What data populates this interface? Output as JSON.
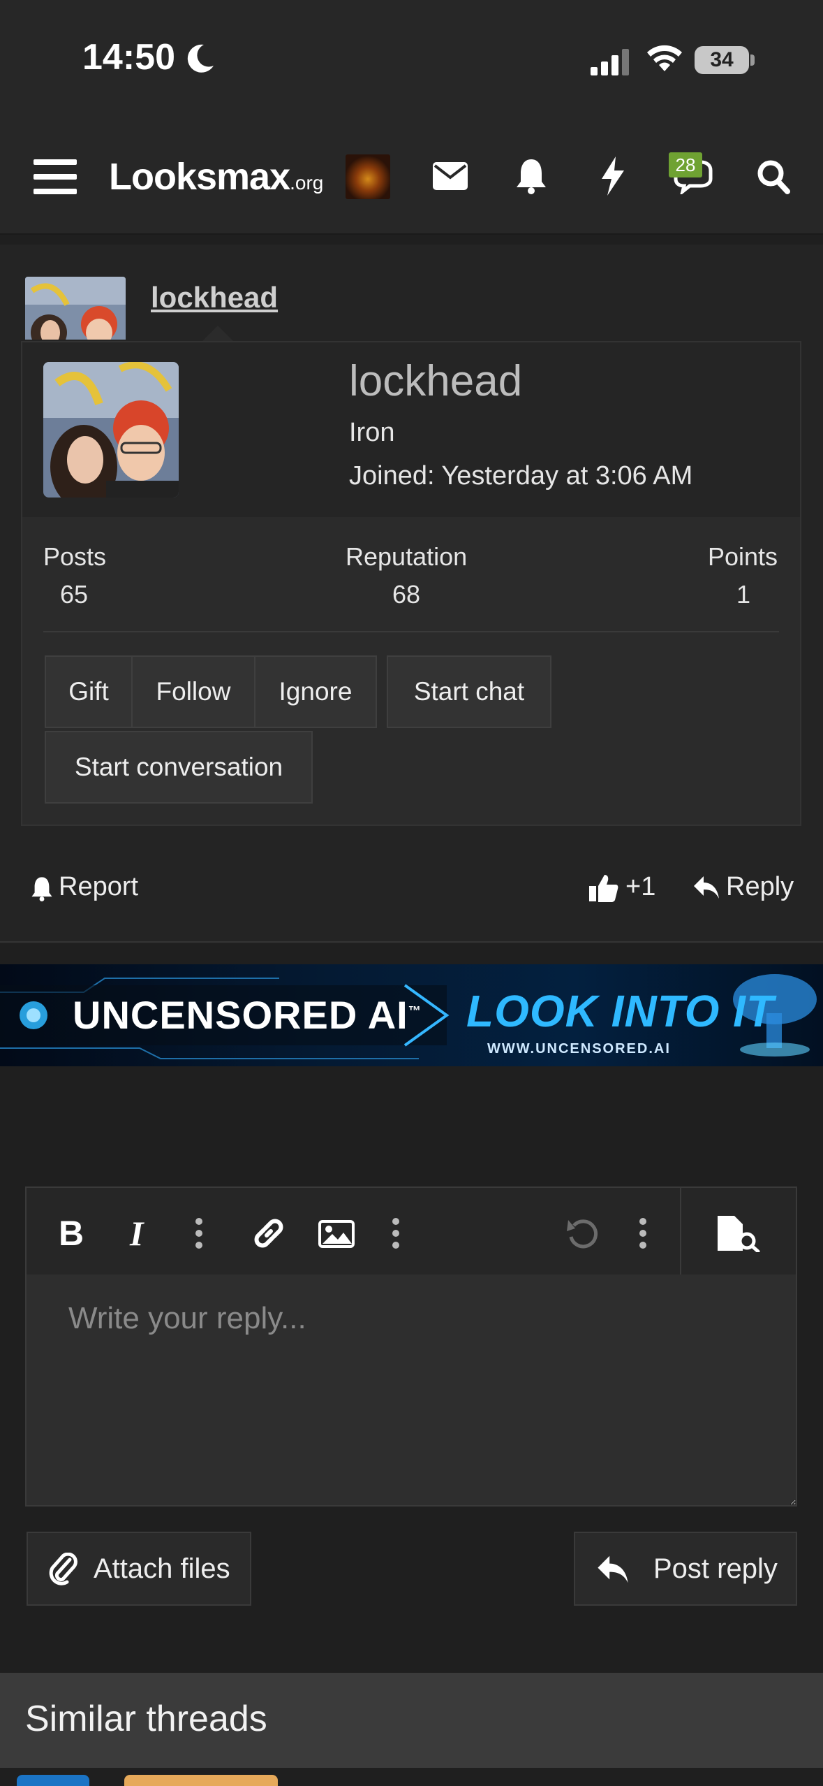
{
  "status_bar": {
    "time": "14:50",
    "battery": "34"
  },
  "header": {
    "logo": "Looksmax",
    "logo_suffix": ".org",
    "conversations_badge": "28",
    "icons": [
      "menu-icon",
      "mail-icon",
      "bell-icon",
      "lightning-icon",
      "chat-icon",
      "search-icon"
    ]
  },
  "post": {
    "username": "lockhead"
  },
  "profile_popup": {
    "username": "lockhead",
    "rank": "Iron",
    "joined": "Joined: Yesterday at 3:06 AM",
    "stats": [
      {
        "label": "Posts",
        "value": "65"
      },
      {
        "label": "Reputation",
        "value": "68"
      },
      {
        "label": "Points",
        "value": "1"
      }
    ],
    "buttons": {
      "gift": "Gift",
      "follow": "Follow",
      "ignore": "Ignore",
      "start_chat": "Start chat",
      "start_conversation": "Start conversation"
    }
  },
  "post_actions": {
    "report": "Report",
    "likes": "+1",
    "reply": "Reply"
  },
  "banner": {
    "left_text": "UNCENSORED AI",
    "tm": "™",
    "right_text": "LOOK INTO IT",
    "url": "WWW.UNCENSORED.AI"
  },
  "editor": {
    "placeholder": "Write your reply..."
  },
  "form_buttons": {
    "attach": "Attach files",
    "post_reply": "Post reply"
  },
  "similar_threads": {
    "title": "Similar threads"
  },
  "colors": {
    "accent_green": "#6fa232",
    "banner_blue": "#2fb9ff",
    "background": "#1f1f1f"
  }
}
